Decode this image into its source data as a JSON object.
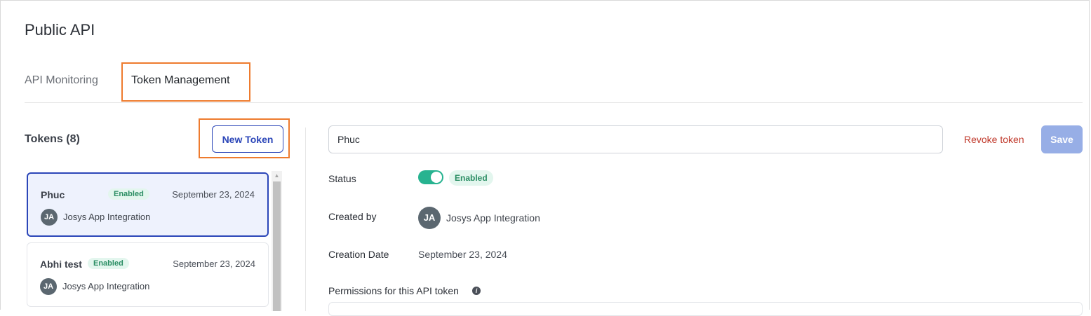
{
  "page": {
    "title": "Public API"
  },
  "tabs": [
    {
      "label": "API Monitoring",
      "active": false
    },
    {
      "label": "Token Management",
      "active": true
    }
  ],
  "tokens": {
    "title": "Tokens (8)",
    "new_button_label": "New Token",
    "list": [
      {
        "name": "Phuc",
        "status": "Enabled",
        "date": "September 23, 2024",
        "owner_initials": "JA",
        "owner": "Josys App Integration",
        "selected": true
      },
      {
        "name": "Abhi test",
        "status": "Enabled",
        "date": "September 23, 2024",
        "owner_initials": "JA",
        "owner": "Josys App Integration",
        "selected": false
      }
    ]
  },
  "detail": {
    "name_value": "Phuc",
    "revoke_label": "Revoke token",
    "save_label": "Save",
    "status_label": "Status",
    "status_value": "Enabled",
    "status_enabled": true,
    "created_by_label": "Created by",
    "created_by_initials": "JA",
    "created_by_name": "Josys App Integration",
    "creation_date_label": "Creation Date",
    "creation_date_value": "September 23, 2024",
    "permissions_label": "Permissions for this API token",
    "info_glyph": "i"
  },
  "colors": {
    "accent": "#2b46b8",
    "highlight": "#ee7b2e",
    "enabled_green": "#27b390",
    "revoke_red": "#c0392b",
    "save_disabled": "#97aee6"
  }
}
